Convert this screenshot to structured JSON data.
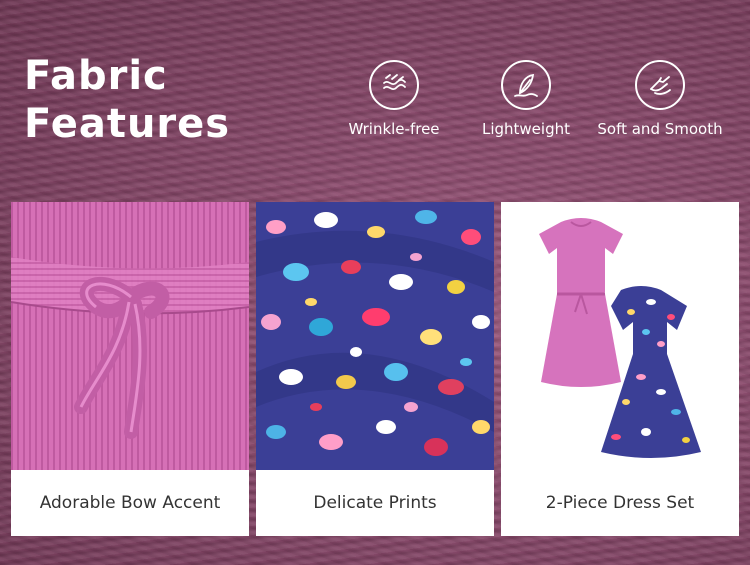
{
  "heading": {
    "line1": "Fabric",
    "line2": "Features"
  },
  "features": [
    {
      "label": "Wrinkle-free",
      "icon": "wrinkle-free-icon"
    },
    {
      "label": "Lightweight",
      "icon": "feather-icon"
    },
    {
      "label": "Soft and Smooth",
      "icon": "hand-smooth-icon"
    }
  ],
  "cards": [
    {
      "caption": "Adorable Bow Accent"
    },
    {
      "caption": "Delicate Prints"
    },
    {
      "caption": "2-Piece Dress Set"
    }
  ],
  "colors": {
    "background": "#8a4a6c",
    "rib_pink": "#d86fb8",
    "print_navy": "#3c3f95",
    "text_light": "#ffffff",
    "text_dark": "#333333"
  }
}
